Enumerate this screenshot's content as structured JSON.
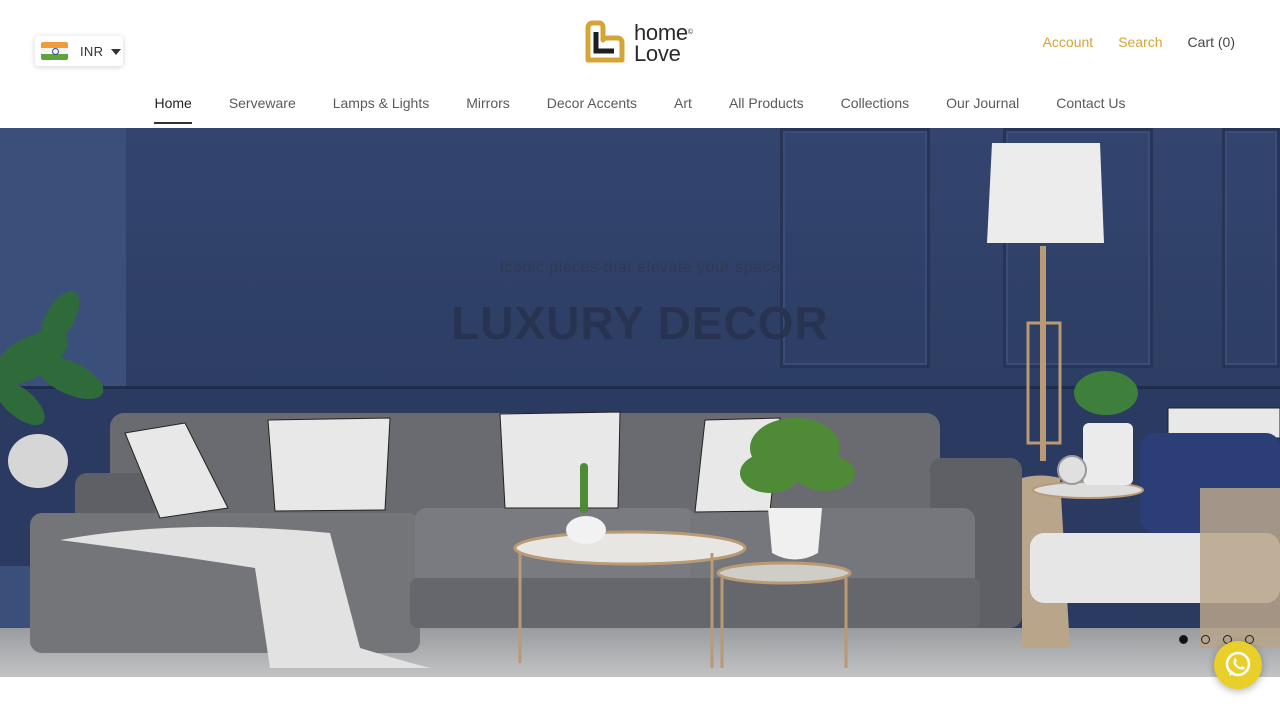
{
  "currency": {
    "code": "INR"
  },
  "logo": {
    "line1": "home",
    "line2": "Love",
    "mark": "©"
  },
  "top_links": {
    "account": "Account",
    "search": "Search",
    "cart": "Cart (0)"
  },
  "nav": [
    {
      "label": "Home",
      "active": true
    },
    {
      "label": "Serveware"
    },
    {
      "label": "Lamps & Lights"
    },
    {
      "label": "Mirrors"
    },
    {
      "label": "Decor Accents"
    },
    {
      "label": "Art"
    },
    {
      "label": "All Products"
    },
    {
      "label": "Collections"
    },
    {
      "label": "Our Journal"
    },
    {
      "label": "Contact Us"
    }
  ],
  "hero": {
    "subtitle": "Iconic pieces that elevate your space",
    "title": "LUXURY DECOR",
    "slides": 4,
    "active_slide": 1
  },
  "colors": {
    "accent": "#d4a437",
    "wall": "#33456f",
    "whatsapp": "#e9cf2a"
  }
}
